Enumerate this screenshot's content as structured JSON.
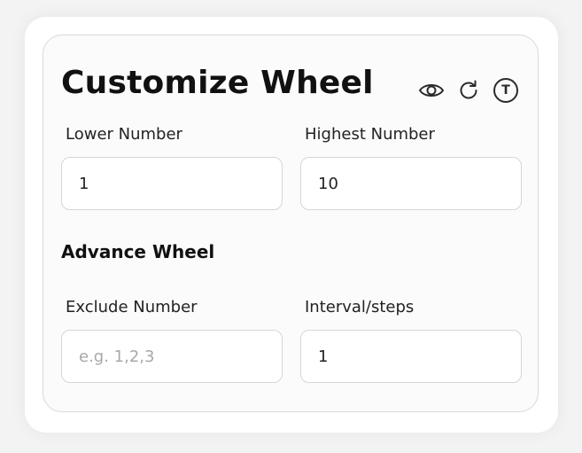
{
  "header": {
    "title": "Customize Wheel"
  },
  "icons": {
    "preview": "eye-icon",
    "reset": "refresh-icon",
    "text": "T"
  },
  "range": {
    "lower_label": "Lower Number",
    "lower_value": "1",
    "highest_label": "Highest Number",
    "highest_value": "10"
  },
  "advanced": {
    "title": "Advance Wheel",
    "exclude_label": "Exclude Number",
    "exclude_value": "",
    "exclude_placeholder": "e.g. 1,2,3",
    "interval_label": "Interval/steps",
    "interval_value": "1"
  }
}
